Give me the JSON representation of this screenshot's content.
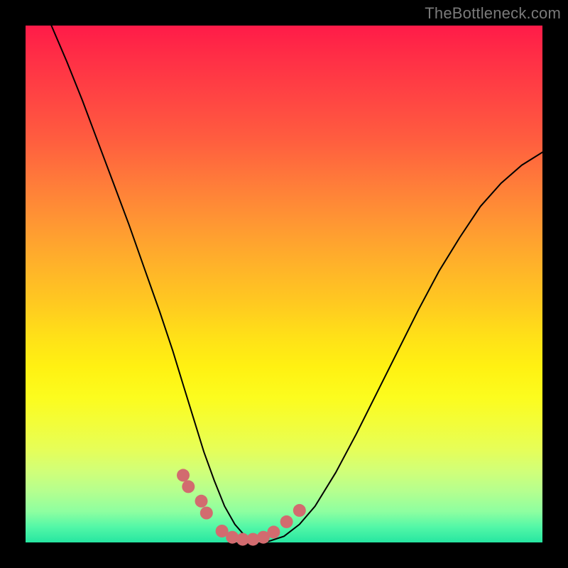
{
  "watermark": "TheBottleneck.com",
  "chart_data": {
    "type": "line",
    "title": "",
    "xlabel": "",
    "ylabel": "",
    "xlim": [
      0,
      1
    ],
    "ylim": [
      0,
      1
    ],
    "background_gradient": {
      "top": "#ff1b48",
      "bottom": "#26e6a1"
    },
    "series": [
      {
        "name": "bottleneck-curve",
        "color": "#000000",
        "x": [
          0.05,
          0.08,
          0.11,
          0.14,
          0.17,
          0.2,
          0.23,
          0.26,
          0.285,
          0.305,
          0.325,
          0.345,
          0.365,
          0.385,
          0.405,
          0.425,
          0.445,
          0.47,
          0.5,
          0.53,
          0.56,
          0.6,
          0.64,
          0.68,
          0.72,
          0.76,
          0.8,
          0.84,
          0.88,
          0.92,
          0.96,
          1.0
        ],
        "y": [
          1.0,
          0.93,
          0.855,
          0.775,
          0.695,
          0.615,
          0.53,
          0.445,
          0.37,
          0.305,
          0.24,
          0.175,
          0.12,
          0.07,
          0.035,
          0.012,
          0.003,
          0.002,
          0.012,
          0.035,
          0.07,
          0.135,
          0.21,
          0.29,
          0.37,
          0.45,
          0.525,
          0.59,
          0.65,
          0.695,
          0.73,
          0.755
        ]
      }
    ],
    "markers": {
      "name": "highlighted-points",
      "color": "#d26b6f",
      "radius": 9,
      "x": [
        0.305,
        0.315,
        0.34,
        0.35,
        0.38,
        0.4,
        0.42,
        0.44,
        0.46,
        0.48,
        0.505,
        0.53
      ],
      "y": [
        0.13,
        0.108,
        0.08,
        0.057,
        0.022,
        0.01,
        0.006,
        0.006,
        0.01,
        0.02,
        0.04,
        0.062
      ]
    }
  }
}
